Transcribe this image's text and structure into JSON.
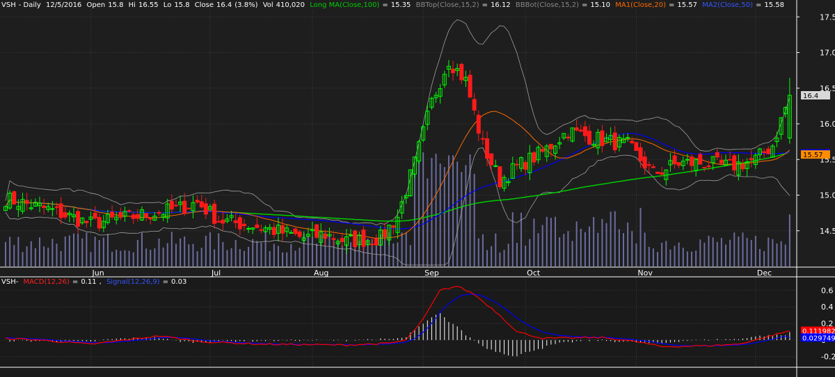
{
  "header": {
    "symbol": "VSH",
    "interval": "Daily",
    "date": "12/5/2016",
    "open_label": "Open",
    "open": "15.8",
    "high_label": "Hi",
    "high": "16.55",
    "low_label": "Lo",
    "low": "15.8",
    "close_label": "Close",
    "close": "16.4",
    "change": "(3.8%)",
    "vol_label": "Vol",
    "volume": "410,020",
    "long_ma_label": "Long MA(Close,100)",
    "long_ma": "15.35",
    "bbtop_label": "BBTop(Close,15,2)",
    "bbtop": "16.12",
    "bbbot_label": "BBBot(Close,15,2)",
    "bbbot": "15.10",
    "ma1_label": "MA1(Close,20)",
    "ma1": "15.57",
    "ma2_label": "MA2(Close,50)",
    "ma2": "15.58"
  },
  "macd_header": {
    "symbol": "VSH",
    "macd_label": "MACD(12,26)",
    "macd": "0.11",
    "signal_label": "Signal(12,26,9)",
    "signal": "0.03"
  },
  "price_tags": {
    "last": "16.4",
    "ma2": "15.584",
    "ma1": "15.57"
  },
  "macd_tags": {
    "macd": "0.111982",
    "signal": "0.029749"
  },
  "colors": {
    "background": "#1e1e1e",
    "grid": "#3c3c3c",
    "up": "#00ff00",
    "down": "#ff1a1a",
    "long_ma": "#00cc00",
    "bb": "#a0a0a0",
    "ma1": "#ff6a00",
    "ma2": "#0000ff",
    "volume": "#6c6ca0",
    "macd": "#ff0000",
    "signal": "#0000ff",
    "hist": "#ffffff",
    "last_tag_bg": "#d8d8d8",
    "ma2_tag_bg": "#0000ff",
    "ma1_tag_bg": "#ff8c00",
    "macd_tag_bg": "#ff0000",
    "signal_tag_bg": "#0000ff"
  },
  "chart_data": [
    {
      "type": "candlestick",
      "title": "VSH - Daily 12/5/2016",
      "x_ticks": [
        "Jun",
        "Jul",
        "Aug",
        "Sep",
        "Oct",
        "Nov",
        "Dec"
      ],
      "y_ticks": [
        "17.5",
        "17.0",
        "16.5",
        "16.0",
        "15.5",
        "15.0",
        "14.5"
      ],
      "ylim": [
        14.0,
        17.6
      ],
      "series_names": [
        "Long MA(Close,100)",
        "BBTop(Close,15,2)",
        "BBBot(Close,15,2)",
        "MA1(Close,20)",
        "MA2(Close,50)"
      ],
      "close_key_points": [
        [
          0,
          14.95
        ],
        [
          10,
          14.8
        ],
        [
          20,
          14.6
        ],
        [
          30,
          14.7
        ],
        [
          40,
          14.8
        ],
        [
          45,
          14.9
        ],
        [
          50,
          14.65
        ],
        [
          60,
          14.55
        ],
        [
          70,
          14.4
        ],
        [
          75,
          14.45
        ],
        [
          80,
          14.35
        ],
        [
          88,
          14.4
        ],
        [
          92,
          14.7
        ],
        [
          96,
          15.45
        ],
        [
          100,
          16.3
        ],
        [
          104,
          16.9
        ],
        [
          108,
          16.6
        ],
        [
          112,
          15.7
        ],
        [
          116,
          15.2
        ],
        [
          120,
          15.4
        ],
        [
          126,
          15.6
        ],
        [
          132,
          15.9
        ],
        [
          138,
          15.8
        ],
        [
          146,
          15.7
        ],
        [
          152,
          15.3
        ],
        [
          158,
          15.45
        ],
        [
          164,
          15.45
        ],
        [
          170,
          15.4
        ],
        [
          176,
          15.5
        ],
        [
          180,
          15.7
        ],
        [
          184,
          16.4
        ]
      ],
      "long_ma_end": 15.35,
      "ma1_end": 15.57,
      "ma2_end": 15.58,
      "bbtop_end": 16.12,
      "bbbot_end": 15.1,
      "last_close": 16.4
    },
    {
      "type": "line",
      "title": "MACD(12,26)",
      "y_ticks": [
        "0.6",
        "0.4",
        "0.2",
        "0",
        "-0.2"
      ],
      "ylim": [
        -0.32,
        0.72
      ],
      "macd_key_points": [
        [
          0,
          0.02
        ],
        [
          8,
          0.0
        ],
        [
          20,
          -0.05
        ],
        [
          36,
          0.05
        ],
        [
          46,
          -0.02
        ],
        [
          60,
          -0.05
        ],
        [
          80,
          -0.06
        ],
        [
          90,
          -0.04
        ],
        [
          94,
          0.0
        ],
        [
          98,
          0.25
        ],
        [
          102,
          0.6
        ],
        [
          106,
          0.65
        ],
        [
          110,
          0.55
        ],
        [
          116,
          0.3
        ],
        [
          120,
          0.1
        ],
        [
          126,
          0.02
        ],
        [
          140,
          0.03
        ],
        [
          148,
          -0.02
        ],
        [
          154,
          -0.08
        ],
        [
          164,
          -0.07
        ],
        [
          172,
          -0.05
        ],
        [
          184,
          0.11
        ]
      ],
      "macd_end": 0.11,
      "signal_end": 0.03
    }
  ]
}
